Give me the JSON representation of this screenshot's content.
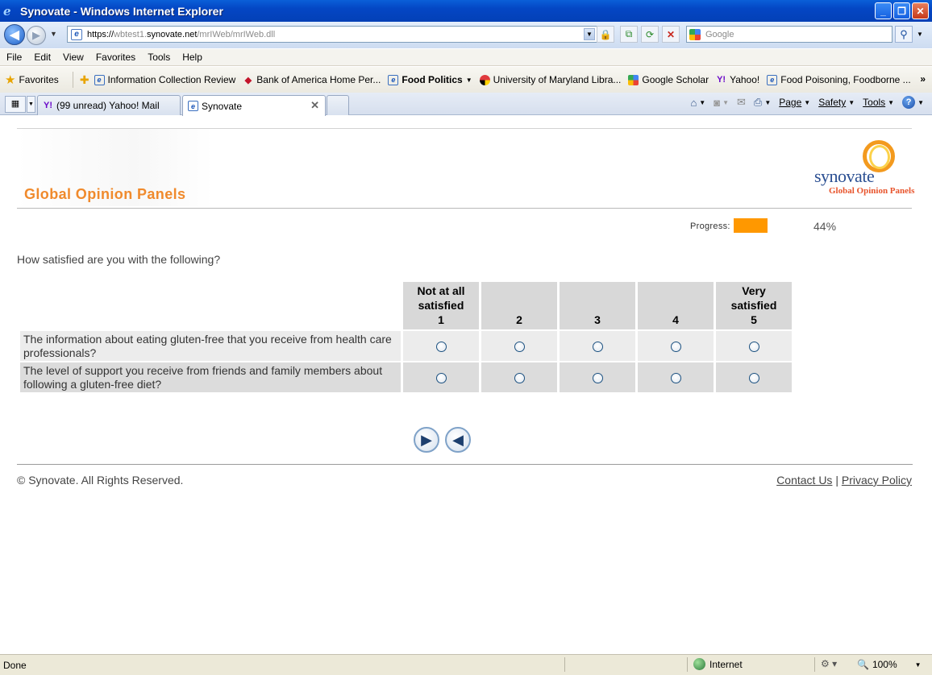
{
  "window": {
    "title": "Synovate - Windows Internet Explorer"
  },
  "address_bar": {
    "url_scheme": "https://",
    "url_host_dim": "wbtest1.",
    "url_host": "synovate.net",
    "url_path": "/mrIWeb/mrIWeb.dll",
    "search_placeholder": "Google"
  },
  "menu": {
    "items": [
      "File",
      "Edit",
      "View",
      "Favorites",
      "Tools",
      "Help"
    ]
  },
  "favorites_bar": {
    "favorites_label": "Favorites",
    "items": [
      "Information Collection Review",
      "Bank of America  Home  Per...",
      "Food Politics",
      "University of Maryland Libra...",
      "Google Scholar",
      "Yahoo!",
      "Food Poisoning, Foodborne ..."
    ],
    "more": "»"
  },
  "tabs": {
    "inactive_label": "(99 unread) Yahoo! Mail",
    "active_label": "Synovate"
  },
  "command_bar": {
    "page": "Page",
    "safety": "Safety",
    "tools": "Tools"
  },
  "page": {
    "brand_title": "Global Opinion Panels",
    "logo_name": "synovate",
    "logo_sub": "Global Opinion Panels",
    "progress_label": "Progress:",
    "progress_fraction": 0.44,
    "progress_text": "44%",
    "question": "How satisfied are you with the following?",
    "scale": [
      {
        "top": "Not at all",
        "mid": "satisfied",
        "num": "1"
      },
      {
        "top": "",
        "mid": "",
        "num": "2"
      },
      {
        "top": "",
        "mid": "",
        "num": "3"
      },
      {
        "top": "",
        "mid": "",
        "num": "4"
      },
      {
        "top": "Very",
        "mid": "satisfied",
        "num": "5"
      }
    ],
    "statements": [
      "The information about eating gluten-free that you receive from health care professionals?",
      "The level of support you receive from friends and family members about following a gluten-free diet?"
    ],
    "copyright": "© Synovate. All Rights Reserved.",
    "contact_link": "Contact Us",
    "separator": "|",
    "privacy_link": "Privacy Policy"
  },
  "status_bar": {
    "status": "Done",
    "zone": "Internet",
    "zoom": "100%"
  },
  "icons": {
    "accent_orange": "#ff9800",
    "brand_orange": "#f08a2c",
    "ie_blue": "#0446c4"
  }
}
